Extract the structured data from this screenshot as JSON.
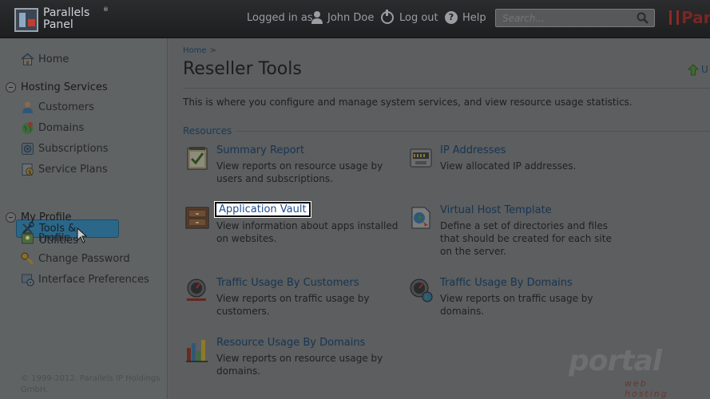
{
  "header": {
    "logo_line1": "Parallels",
    "logo_tm": "®",
    "logo_line2": "Panel",
    "logged_in_as": "Logged in as",
    "user_name": "John Doe",
    "logout": "Log out",
    "help_glyph": "?",
    "help": "Help",
    "search_placeholder": "Search...",
    "brand": "Par"
  },
  "sidebar": {
    "home": "Home",
    "hosting_services": "Hosting Services",
    "hosting_items": [
      "Customers",
      "Domains",
      "Subscriptions",
      "Service Plans",
      "Tools & Utilities"
    ],
    "my_profile": "My Profile",
    "profile_items": [
      "Profile",
      "Change Password",
      "Interface Preferences"
    ],
    "copyright": "© 1999-2012. Parallels IP Holdings GmbH."
  },
  "main": {
    "breadcrumb_home": "Home",
    "breadcrumb_sep": ">",
    "title": "Reseller Tools",
    "up_level": "U",
    "intro": "This is where you configure and manage system services, and view resource usage statistics.",
    "resources_label": "Resources",
    "tools": [
      {
        "title": "Summary Report",
        "desc": "View reports on resource usage by users and subscriptions."
      },
      {
        "title": "IP Addresses",
        "desc": "View allocated IP addresses."
      },
      {
        "title": "Application Vault",
        "desc": "View information about apps installed on websites."
      },
      {
        "title": "Virtual Host Template",
        "desc": "Define a set of directories and files that should be created for each site on the server."
      },
      {
        "title": "Traffic Usage By Customers",
        "desc": "View reports on traffic usage by customers."
      },
      {
        "title": "Traffic Usage By Domains",
        "desc": "View reports on traffic usage by domains."
      },
      {
        "title": "Resource Usage By Domains",
        "desc": "View reports on resource usage by domains."
      }
    ]
  },
  "watermark": {
    "text": "portal",
    "sub": "web hosting"
  },
  "colors": {
    "selected_nav": "#2b6788",
    "link": "#173453",
    "highlight_box": "#ffffff"
  }
}
